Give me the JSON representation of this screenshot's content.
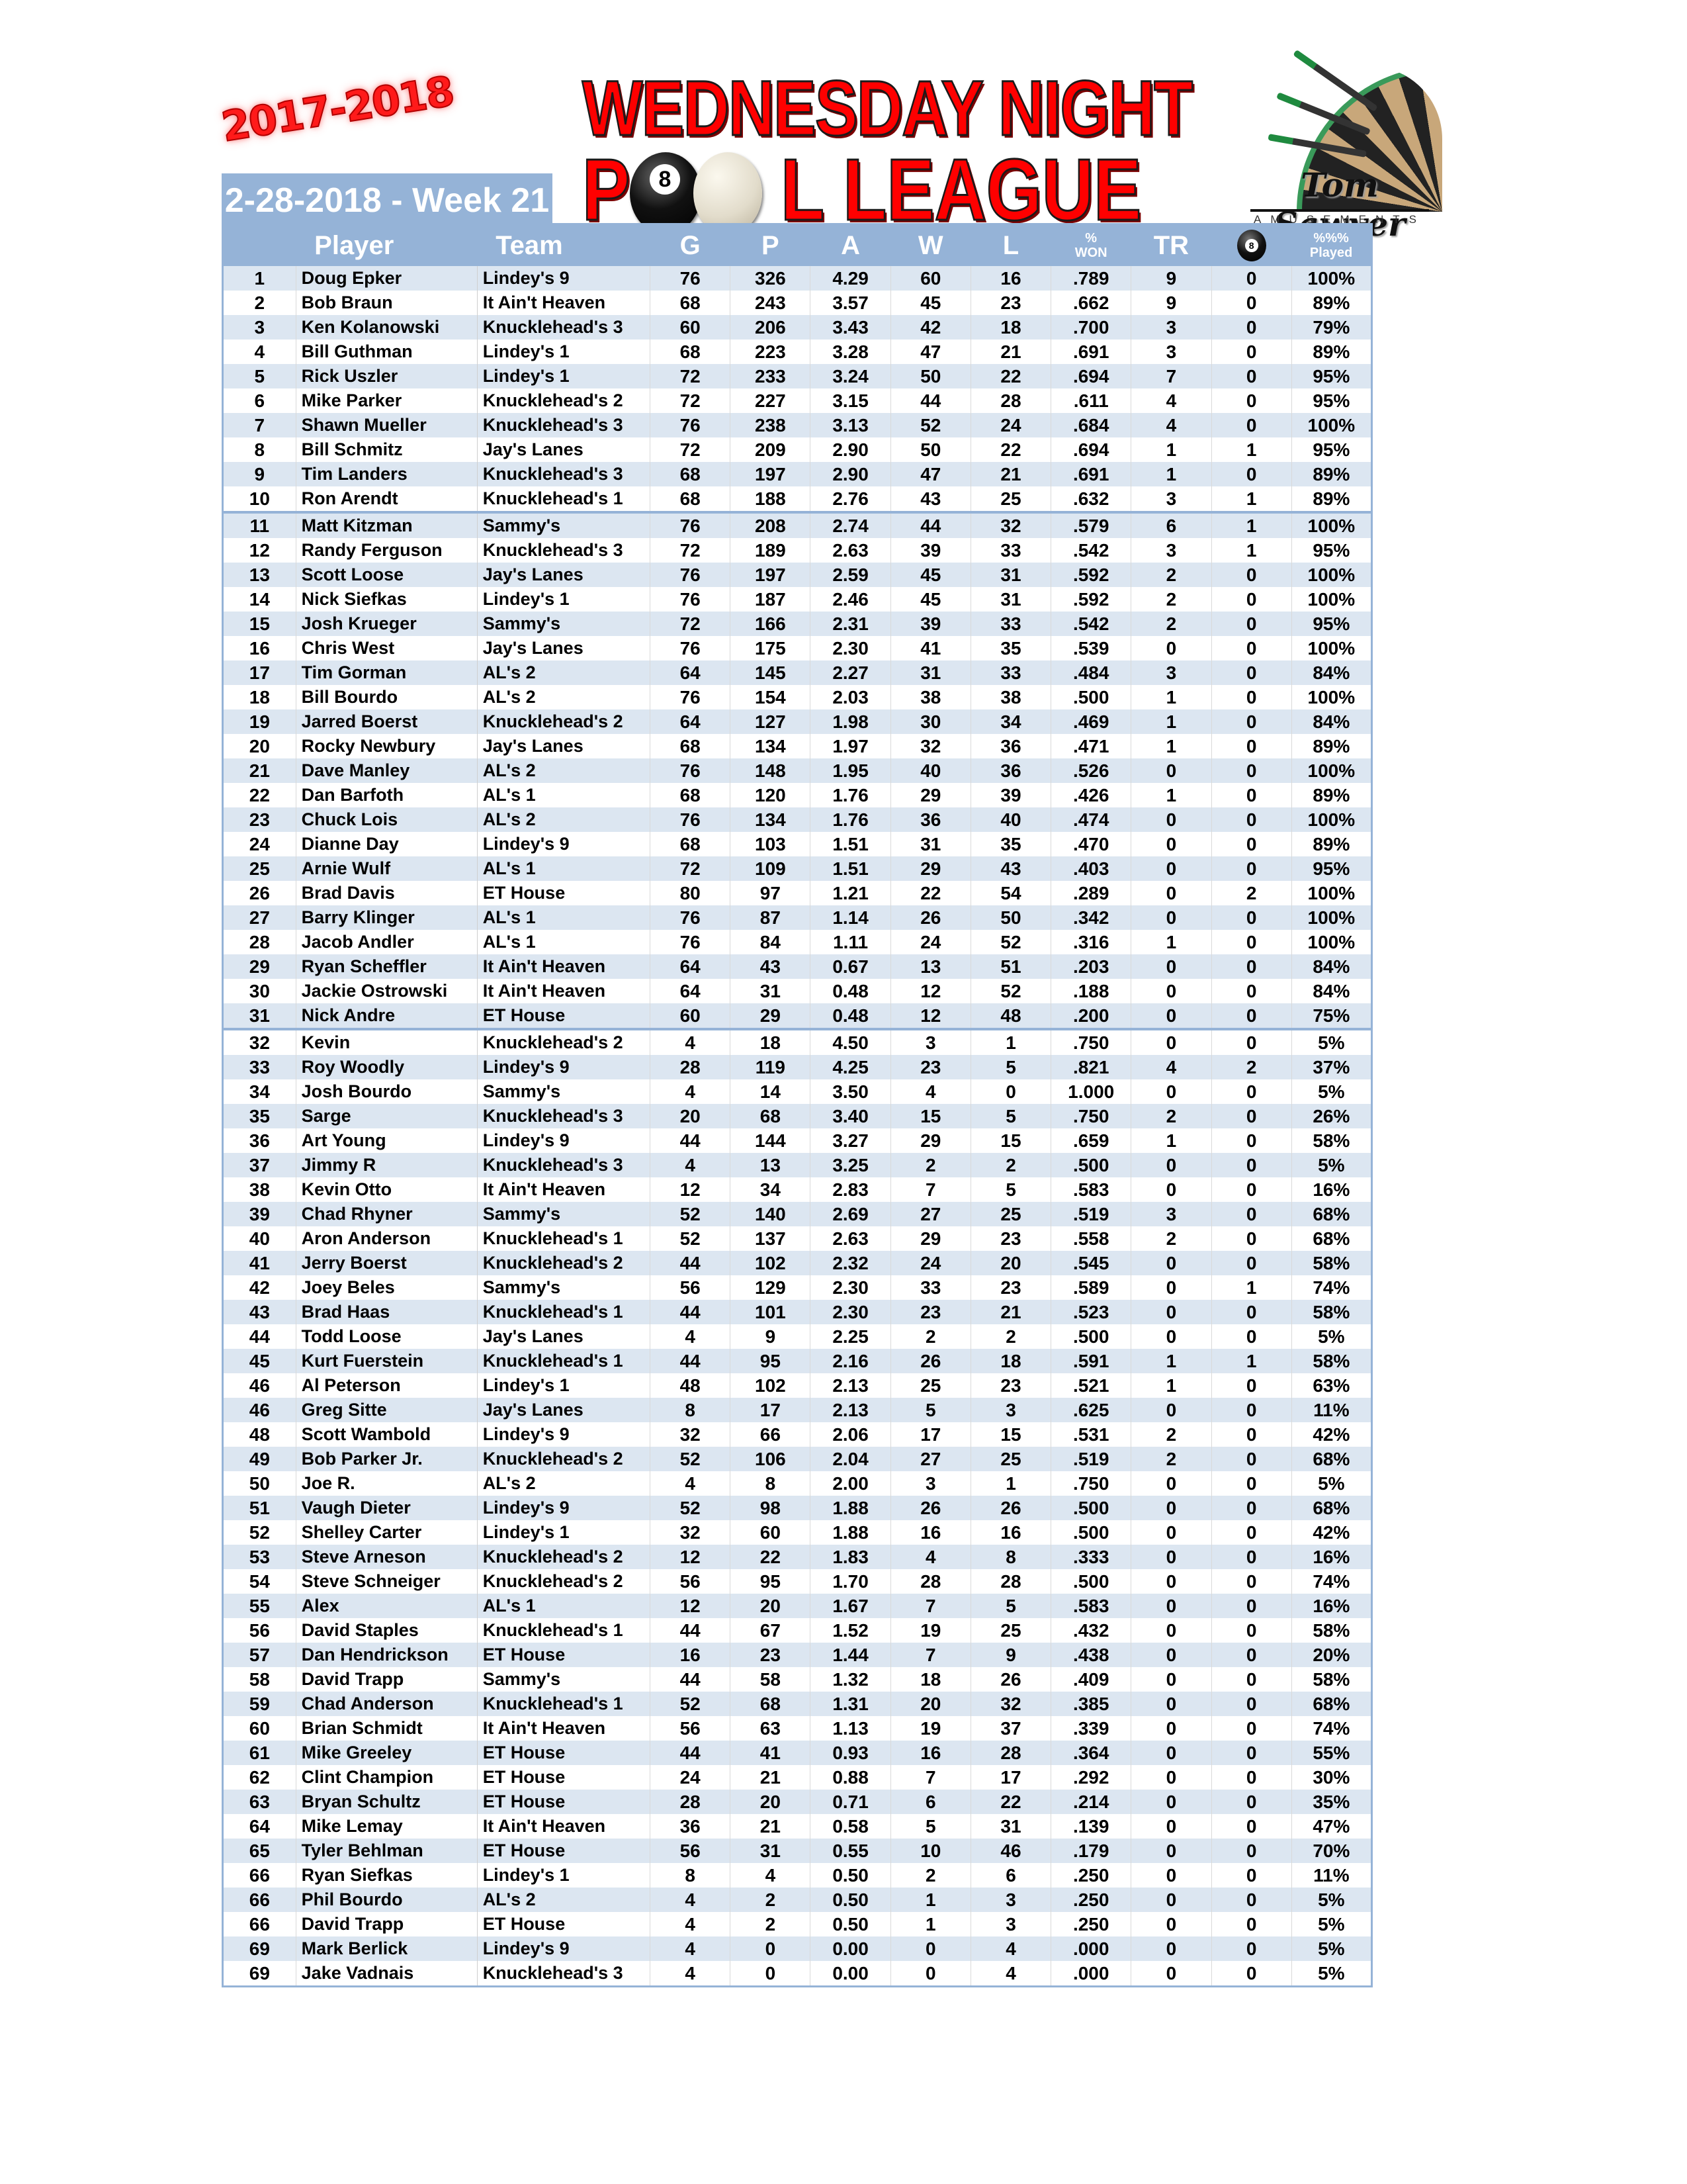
{
  "header": {
    "season": "2017-2018",
    "week_label": "2-28-2018 - Week 21",
    "title_line1": "WEDNESDAY NIGHT",
    "title_line2_first": "P",
    "title_line2_rest": "L  LEAGUE",
    "ball_number": "8",
    "sponsor_name": "Tom Sawyer",
    "sponsor_sub": "AMUSEMENTS"
  },
  "colors": {
    "header_bg": "#95b3d7",
    "row_band": "#dce6f1",
    "title_red": "#ff0000"
  },
  "table": {
    "columns": {
      "rank": "",
      "player": "Player",
      "team": "Team",
      "g": "G",
      "p": "P",
      "a": "A",
      "w": "W",
      "l": "L",
      "won_top": "%",
      "won_bottom": "WON",
      "tr": "TR",
      "eight_icon": "8",
      "played_top": "%%%",
      "played_bottom": "Played"
    },
    "separators_after_rank_index": [
      10,
      31
    ],
    "rows": [
      [
        "1",
        "Doug Epker",
        "Lindey's 9",
        "76",
        "326",
        "4.29",
        "60",
        "16",
        ".789",
        "9",
        "0",
        "100%"
      ],
      [
        "2",
        "Bob Braun",
        "It Ain't Heaven",
        "68",
        "243",
        "3.57",
        "45",
        "23",
        ".662",
        "9",
        "0",
        "89%"
      ],
      [
        "3",
        "Ken Kolanowski",
        "Knucklehead's 3",
        "60",
        "206",
        "3.43",
        "42",
        "18",
        ".700",
        "3",
        "0",
        "79%"
      ],
      [
        "4",
        "Bill Guthman",
        "Lindey's 1",
        "68",
        "223",
        "3.28",
        "47",
        "21",
        ".691",
        "3",
        "0",
        "89%"
      ],
      [
        "5",
        "Rick Uszler",
        "Lindey's 1",
        "72",
        "233",
        "3.24",
        "50",
        "22",
        ".694",
        "7",
        "0",
        "95%"
      ],
      [
        "6",
        "Mike Parker",
        "Knucklehead's 2",
        "72",
        "227",
        "3.15",
        "44",
        "28",
        ".611",
        "4",
        "0",
        "95%"
      ],
      [
        "7",
        "Shawn Mueller",
        "Knucklehead's 3",
        "76",
        "238",
        "3.13",
        "52",
        "24",
        ".684",
        "4",
        "0",
        "100%"
      ],
      [
        "8",
        "Bill Schmitz",
        "Jay's Lanes",
        "72",
        "209",
        "2.90",
        "50",
        "22",
        ".694",
        "1",
        "1",
        "95%"
      ],
      [
        "9",
        "Tim Landers",
        "Knucklehead's 3",
        "68",
        "197",
        "2.90",
        "47",
        "21",
        ".691",
        "1",
        "0",
        "89%"
      ],
      [
        "10",
        "Ron Arendt",
        "Knucklehead's 1",
        "68",
        "188",
        "2.76",
        "43",
        "25",
        ".632",
        "3",
        "1",
        "89%"
      ],
      [
        "11",
        "Matt Kitzman",
        "Sammy's",
        "76",
        "208",
        "2.74",
        "44",
        "32",
        ".579",
        "6",
        "1",
        "100%"
      ],
      [
        "12",
        "Randy Ferguson",
        "Knucklehead's 3",
        "72",
        "189",
        "2.63",
        "39",
        "33",
        ".542",
        "3",
        "1",
        "95%"
      ],
      [
        "13",
        "Scott Loose",
        "Jay's Lanes",
        "76",
        "197",
        "2.59",
        "45",
        "31",
        ".592",
        "2",
        "0",
        "100%"
      ],
      [
        "14",
        "Nick Siefkas",
        "Lindey's 1",
        "76",
        "187",
        "2.46",
        "45",
        "31",
        ".592",
        "2",
        "0",
        "100%"
      ],
      [
        "15",
        "Josh Krueger",
        "Sammy's",
        "72",
        "166",
        "2.31",
        "39",
        "33",
        ".542",
        "2",
        "0",
        "95%"
      ],
      [
        "16",
        "Chris West",
        "Jay's Lanes",
        "76",
        "175",
        "2.30",
        "41",
        "35",
        ".539",
        "0",
        "0",
        "100%"
      ],
      [
        "17",
        "Tim Gorman",
        "AL's 2",
        "64",
        "145",
        "2.27",
        "31",
        "33",
        ".484",
        "3",
        "0",
        "84%"
      ],
      [
        "18",
        "Bill Bourdo",
        "AL's 2",
        "76",
        "154",
        "2.03",
        "38",
        "38",
        ".500",
        "1",
        "0",
        "100%"
      ],
      [
        "19",
        "Jarred Boerst",
        "Knucklehead's 2",
        "64",
        "127",
        "1.98",
        "30",
        "34",
        ".469",
        "1",
        "0",
        "84%"
      ],
      [
        "20",
        "Rocky Newbury",
        "Jay's Lanes",
        "68",
        "134",
        "1.97",
        "32",
        "36",
        ".471",
        "1",
        "0",
        "89%"
      ],
      [
        "21",
        "Dave Manley",
        "AL's 2",
        "76",
        "148",
        "1.95",
        "40",
        "36",
        ".526",
        "0",
        "0",
        "100%"
      ],
      [
        "22",
        "Dan Barfoth",
        "AL's 1",
        "68",
        "120",
        "1.76",
        "29",
        "39",
        ".426",
        "1",
        "0",
        "89%"
      ],
      [
        "23",
        "Chuck Lois",
        "AL's 2",
        "76",
        "134",
        "1.76",
        "36",
        "40",
        ".474",
        "0",
        "0",
        "100%"
      ],
      [
        "24",
        "Dianne Day",
        "Lindey's 9",
        "68",
        "103",
        "1.51",
        "31",
        "35",
        ".470",
        "0",
        "0",
        "89%"
      ],
      [
        "25",
        "Arnie Wulf",
        "AL's 1",
        "72",
        "109",
        "1.51",
        "29",
        "43",
        ".403",
        "0",
        "0",
        "95%"
      ],
      [
        "26",
        "Brad Davis",
        "ET House",
        "80",
        "97",
        "1.21",
        "22",
        "54",
        ".289",
        "0",
        "2",
        "100%"
      ],
      [
        "27",
        "Barry Klinger",
        "AL's 1",
        "76",
        "87",
        "1.14",
        "26",
        "50",
        ".342",
        "0",
        "0",
        "100%"
      ],
      [
        "28",
        "Jacob Andler",
        "AL's 1",
        "76",
        "84",
        "1.11",
        "24",
        "52",
        ".316",
        "1",
        "0",
        "100%"
      ],
      [
        "29",
        "Ryan Scheffler",
        "It Ain't Heaven",
        "64",
        "43",
        "0.67",
        "13",
        "51",
        ".203",
        "0",
        "0",
        "84%"
      ],
      [
        "30",
        "Jackie Ostrowski",
        "It Ain't Heaven",
        "64",
        "31",
        "0.48",
        "12",
        "52",
        ".188",
        "0",
        "0",
        "84%"
      ],
      [
        "31",
        "Nick Andre",
        "ET House",
        "60",
        "29",
        "0.48",
        "12",
        "48",
        ".200",
        "0",
        "0",
        "75%"
      ],
      [
        "32",
        "Kevin",
        "Knucklehead's 2",
        "4",
        "18",
        "4.50",
        "3",
        "1",
        ".750",
        "0",
        "0",
        "5%"
      ],
      [
        "33",
        "Roy Woodly",
        "Lindey's 9",
        "28",
        "119",
        "4.25",
        "23",
        "5",
        ".821",
        "4",
        "2",
        "37%"
      ],
      [
        "34",
        "Josh Bourdo",
        "Sammy's",
        "4",
        "14",
        "3.50",
        "4",
        "0",
        "1.000",
        "0",
        "0",
        "5%"
      ],
      [
        "35",
        "Sarge",
        "Knucklehead's 3",
        "20",
        "68",
        "3.40",
        "15",
        "5",
        ".750",
        "2",
        "0",
        "26%"
      ],
      [
        "36",
        "Art Young",
        "Lindey's 9",
        "44",
        "144",
        "3.27",
        "29",
        "15",
        ".659",
        "1",
        "0",
        "58%"
      ],
      [
        "37",
        "Jimmy R",
        "Knucklehead's 3",
        "4",
        "13",
        "3.25",
        "2",
        "2",
        ".500",
        "0",
        "0",
        "5%"
      ],
      [
        "38",
        "Kevin Otto",
        "It Ain't Heaven",
        "12",
        "34",
        "2.83",
        "7",
        "5",
        ".583",
        "0",
        "0",
        "16%"
      ],
      [
        "39",
        "Chad Rhyner",
        "Sammy's",
        "52",
        "140",
        "2.69",
        "27",
        "25",
        ".519",
        "3",
        "0",
        "68%"
      ],
      [
        "40",
        "Aron Anderson",
        "Knucklehead's 1",
        "52",
        "137",
        "2.63",
        "29",
        "23",
        ".558",
        "2",
        "0",
        "68%"
      ],
      [
        "41",
        "Jerry Boerst",
        "Knucklehead's 2",
        "44",
        "102",
        "2.32",
        "24",
        "20",
        ".545",
        "0",
        "0",
        "58%"
      ],
      [
        "42",
        "Joey Beles",
        "Sammy's",
        "56",
        "129",
        "2.30",
        "33",
        "23",
        ".589",
        "0",
        "1",
        "74%"
      ],
      [
        "43",
        "Brad Haas",
        "Knucklehead's 1",
        "44",
        "101",
        "2.30",
        "23",
        "21",
        ".523",
        "0",
        "0",
        "58%"
      ],
      [
        "44",
        "Todd Loose",
        "Jay's Lanes",
        "4",
        "9",
        "2.25",
        "2",
        "2",
        ".500",
        "0",
        "0",
        "5%"
      ],
      [
        "45",
        "Kurt Fuerstein",
        "Knucklehead's 1",
        "44",
        "95",
        "2.16",
        "26",
        "18",
        ".591",
        "1",
        "1",
        "58%"
      ],
      [
        "46",
        "Al Peterson",
        "Lindey's 1",
        "48",
        "102",
        "2.13",
        "25",
        "23",
        ".521",
        "1",
        "0",
        "63%"
      ],
      [
        "46",
        "Greg Sitte",
        "Jay's Lanes",
        "8",
        "17",
        "2.13",
        "5",
        "3",
        ".625",
        "0",
        "0",
        "11%"
      ],
      [
        "48",
        "Scott Wambold",
        "Lindey's 9",
        "32",
        "66",
        "2.06",
        "17",
        "15",
        ".531",
        "2",
        "0",
        "42%"
      ],
      [
        "49",
        "Bob Parker Jr.",
        "Knucklehead's 2",
        "52",
        "106",
        "2.04",
        "27",
        "25",
        ".519",
        "2",
        "0",
        "68%"
      ],
      [
        "50",
        "Joe R.",
        "AL's 2",
        "4",
        "8",
        "2.00",
        "3",
        "1",
        ".750",
        "0",
        "0",
        "5%"
      ],
      [
        "51",
        "Vaugh Dieter",
        "Lindey's 9",
        "52",
        "98",
        "1.88",
        "26",
        "26",
        ".500",
        "0",
        "0",
        "68%"
      ],
      [
        "52",
        "Shelley Carter",
        "Lindey's 1",
        "32",
        "60",
        "1.88",
        "16",
        "16",
        ".500",
        "0",
        "0",
        "42%"
      ],
      [
        "53",
        "Steve Arneson",
        "Knucklehead's 2",
        "12",
        "22",
        "1.83",
        "4",
        "8",
        ".333",
        "0",
        "0",
        "16%"
      ],
      [
        "54",
        "Steve Schneiger",
        "Knucklehead's 2",
        "56",
        "95",
        "1.70",
        "28",
        "28",
        ".500",
        "0",
        "0",
        "74%"
      ],
      [
        "55",
        "Alex",
        "AL's 1",
        "12",
        "20",
        "1.67",
        "7",
        "5",
        ".583",
        "0",
        "0",
        "16%"
      ],
      [
        "56",
        "David Staples",
        "Knucklehead's 1",
        "44",
        "67",
        "1.52",
        "19",
        "25",
        ".432",
        "0",
        "0",
        "58%"
      ],
      [
        "57",
        "Dan Hendrickson",
        "ET House",
        "16",
        "23",
        "1.44",
        "7",
        "9",
        ".438",
        "0",
        "0",
        "20%"
      ],
      [
        "58",
        "David Trapp",
        "Sammy's",
        "44",
        "58",
        "1.32",
        "18",
        "26",
        ".409",
        "0",
        "0",
        "58%"
      ],
      [
        "59",
        "Chad Anderson",
        "Knucklehead's 1",
        "52",
        "68",
        "1.31",
        "20",
        "32",
        ".385",
        "0",
        "0",
        "68%"
      ],
      [
        "60",
        "Brian Schmidt",
        "It Ain't Heaven",
        "56",
        "63",
        "1.13",
        "19",
        "37",
        ".339",
        "0",
        "0",
        "74%"
      ],
      [
        "61",
        "Mike Greeley",
        "ET House",
        "44",
        "41",
        "0.93",
        "16",
        "28",
        ".364",
        "0",
        "0",
        "55%"
      ],
      [
        "62",
        "Clint Champion",
        "ET House",
        "24",
        "21",
        "0.88",
        "7",
        "17",
        ".292",
        "0",
        "0",
        "30%"
      ],
      [
        "63",
        "Bryan Schultz",
        "ET House",
        "28",
        "20",
        "0.71",
        "6",
        "22",
        ".214",
        "0",
        "0",
        "35%"
      ],
      [
        "64",
        "Mike Lemay",
        "It Ain't Heaven",
        "36",
        "21",
        "0.58",
        "5",
        "31",
        ".139",
        "0",
        "0",
        "47%"
      ],
      [
        "65",
        "Tyler Behlman",
        "ET House",
        "56",
        "31",
        "0.55",
        "10",
        "46",
        ".179",
        "0",
        "0",
        "70%"
      ],
      [
        "66",
        "Ryan Siefkas",
        "Lindey's 1",
        "8",
        "4",
        "0.50",
        "2",
        "6",
        ".250",
        "0",
        "0",
        "11%"
      ],
      [
        "66",
        "Phil Bourdo",
        "AL's 2",
        "4",
        "2",
        "0.50",
        "1",
        "3",
        ".250",
        "0",
        "0",
        "5%"
      ],
      [
        "66",
        "David Trapp",
        "ET House",
        "4",
        "2",
        "0.50",
        "1",
        "3",
        ".250",
        "0",
        "0",
        "5%"
      ],
      [
        "69",
        "Mark Berlick",
        "Lindey's 9",
        "4",
        "0",
        "0.00",
        "0",
        "4",
        ".000",
        "0",
        "0",
        "5%"
      ],
      [
        "69",
        "Jake Vadnais",
        "Knucklehead's 3",
        "4",
        "0",
        "0.00",
        "0",
        "4",
        ".000",
        "0",
        "0",
        "5%"
      ]
    ]
  }
}
